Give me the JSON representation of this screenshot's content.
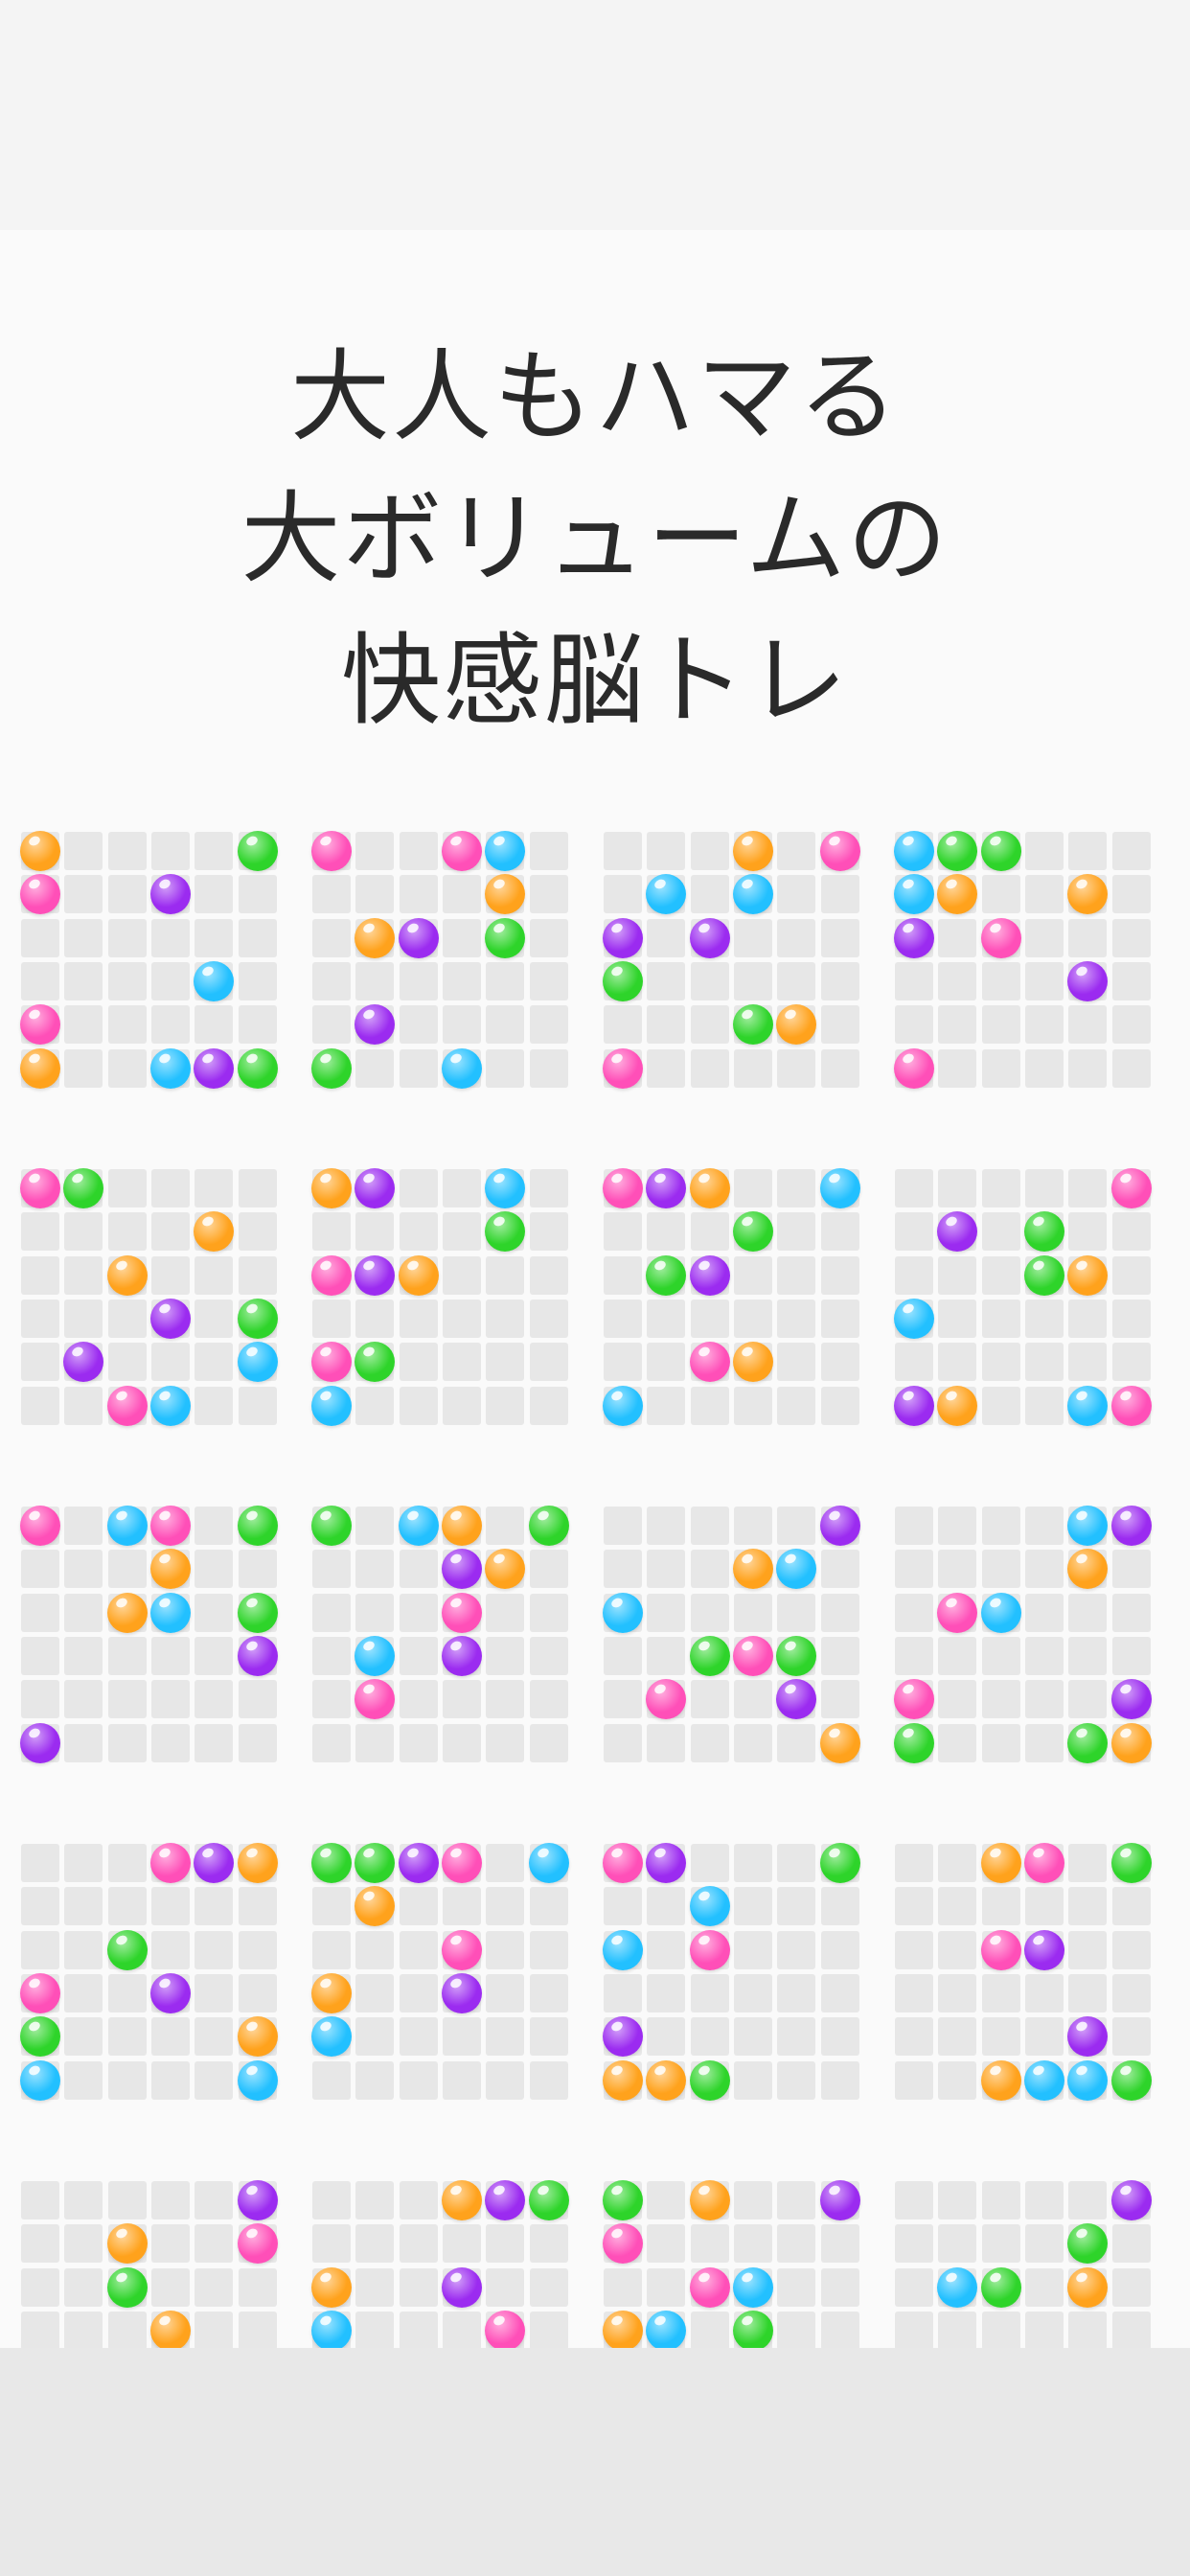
{
  "headline": {
    "line1": "大人もハマる",
    "line2": "大ボリュームの",
    "line3": "快感脳トレ"
  },
  "colors": {
    "O": "#ffa21c",
    "G": "#2ed42a",
    "P": "#ff4fb8",
    "V": "#9b2bf0",
    "C": "#22c0ff"
  },
  "boards": [
    [
      "O....G",
      "P..V..",
      "......",
      "....C.",
      "P.....",
      "O..CVG"
    ],
    [
      "P..PC.",
      "....O.",
      ".OV.G.",
      "......",
      ".V....",
      "G..C.."
    ],
    [
      "...O.P",
      ".C.C..",
      "V.V...",
      "G.....",
      "...GO.",
      "P....."
    ],
    [
      "CGG...",
      "CO..O.",
      "V.P...",
      "....V.",
      "......",
      "P....."
    ],
    [
      "PG....",
      "....O.",
      "..O...",
      "...V.G",
      ".V...C",
      "..PC.."
    ],
    [
      "OV..C.",
      "....G.",
      "PVO...",
      "......",
      "PG....",
      "C....."
    ],
    [
      "PVO..C",
      "...G..",
      ".GV...",
      "......",
      "..PO..",
      "C....."
    ],
    [
      ".....P",
      ".V.G..",
      "...GO.",
      "C.....",
      "......",
      "VO..CP"
    ],
    [
      "P.CP.G",
      "...O..",
      "..OC.G",
      ".....V",
      "......",
      "V....."
    ],
    [
      "G.CO.G",
      "...VO.",
      "...P..",
      ".C.V..",
      ".P....",
      "......"
    ],
    [
      ".....V",
      "...OC.",
      "C.....",
      "..GPG.",
      ".P..V.",
      ".....O"
    ],
    [
      "....CV",
      "....O.",
      ".PC...",
      "......",
      "P....V",
      "G...GO"
    ],
    [
      "...PVO",
      "......",
      "..G...",
      "P..V..",
      "G....O",
      "C....C"
    ],
    [
      "GGVP.C",
      ".O....",
      "...P..",
      "O..V..",
      "C.....",
      "......"
    ],
    [
      "PV...G",
      "..C...",
      "C.P...",
      "......",
      "V.....",
      "OOG..."
    ],
    [
      "..OP.G",
      "......",
      "..PV..",
      "......",
      "....V.",
      "..OCCG"
    ],
    [
      ".....V",
      "..O..P",
      "..G...",
      "...O..",
      "......",
      "......"
    ],
    [
      "...OVG",
      "......",
      "O..V..",
      "C...P.",
      "......",
      "......"
    ],
    [
      "G.O..V",
      "P.....",
      "..PC..",
      "OC.G..",
      "......",
      "......"
    ],
    [
      ".....V",
      "....G.",
      ".CG.O.",
      "......",
      "......",
      "......"
    ]
  ]
}
